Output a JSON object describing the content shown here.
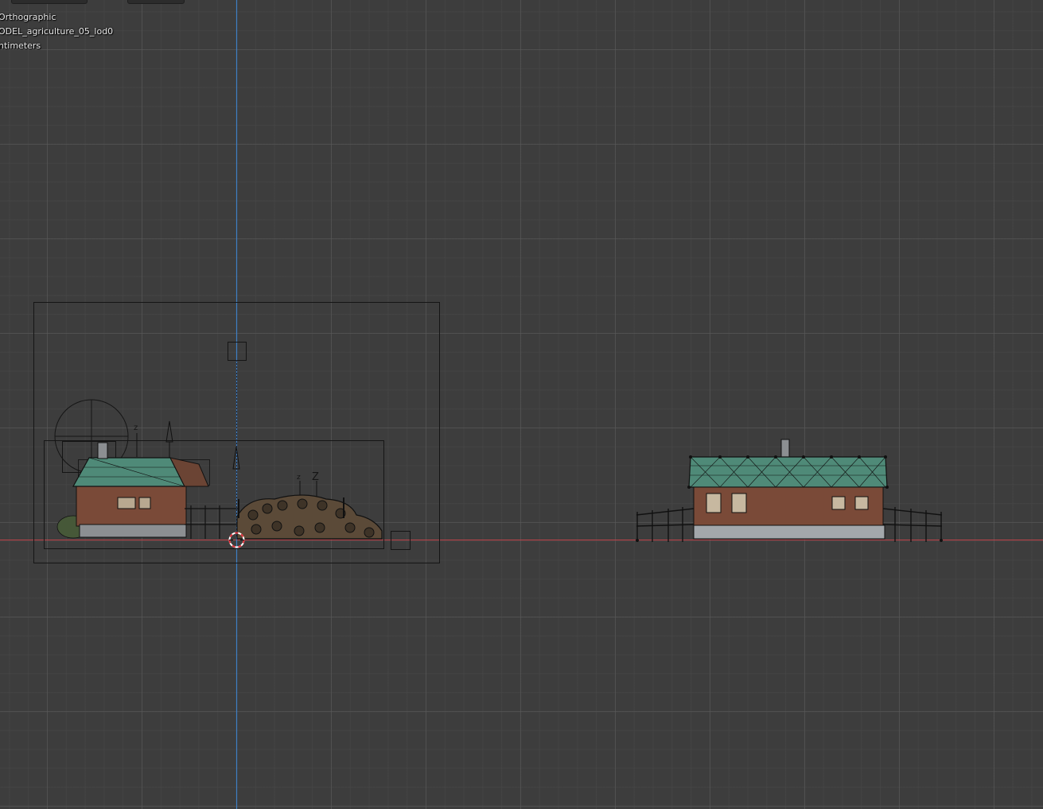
{
  "viewport": {
    "view_mode": "Orthographic",
    "active_object": "ODEL_agriculture_05_lod0",
    "units": "ntimeters"
  },
  "colors": {
    "background": "#3d3d3d",
    "x_axis": "#c0434b",
    "z_axis": "#3f7fc4",
    "roof": "#4f8a78",
    "wall": "#7a4a38",
    "foundation": "#8c8f92",
    "wire": "#111111"
  },
  "empty_labels": {
    "left_small": "z",
    "left_large": "Z",
    "mid_small": "z",
    "mid_large": "Z"
  },
  "icons": [
    "3d-cursor-icon",
    "camera-icon",
    "light-icon",
    "empty-arrow-icon"
  ]
}
